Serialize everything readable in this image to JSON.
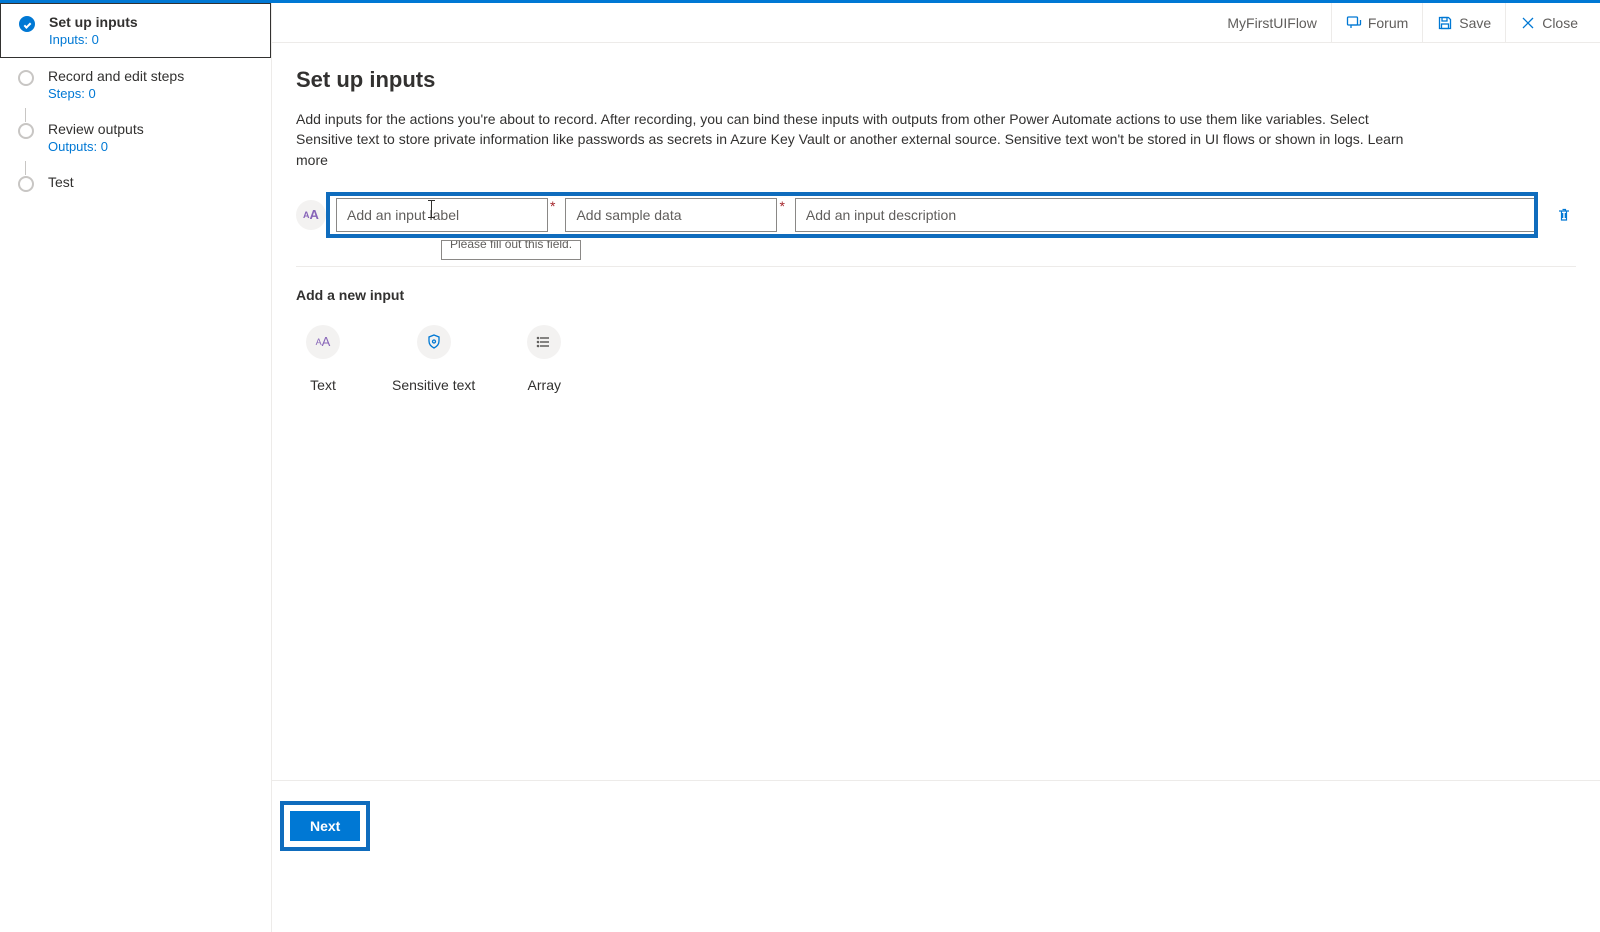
{
  "header": {
    "flow_name": "MyFirstUIFlow",
    "forum": "Forum",
    "save": "Save",
    "close": "Close"
  },
  "sidebar": {
    "steps": [
      {
        "label": "Set up inputs",
        "sub": "Inputs: 0"
      },
      {
        "label": "Record and edit steps",
        "sub": "Steps: 0"
      },
      {
        "label": "Review outputs",
        "sub": "Outputs: 0"
      },
      {
        "label": "Test",
        "sub": ""
      }
    ]
  },
  "page": {
    "title": "Set up inputs",
    "description": "Add inputs for the actions you're about to record. After recording, you can bind these inputs with outputs from other Power Automate actions to use them like variables. Select Sensitive text to store private information like passwords as secrets in Azure Key Vault or another external source. Sensitive text won't be stored in UI flows or shown in logs. Learn more"
  },
  "input_row": {
    "type_icon": "AA",
    "label_placeholder": "Add an input label",
    "sample_placeholder": "Add sample data",
    "desc_placeholder": "Add an input description",
    "tooltip": "Please fill out this field."
  },
  "add_new": {
    "title": "Add a new input",
    "types": [
      {
        "name": "Text"
      },
      {
        "name": "Sensitive text"
      },
      {
        "name": "Array"
      }
    ]
  },
  "footer": {
    "next": "Next"
  }
}
